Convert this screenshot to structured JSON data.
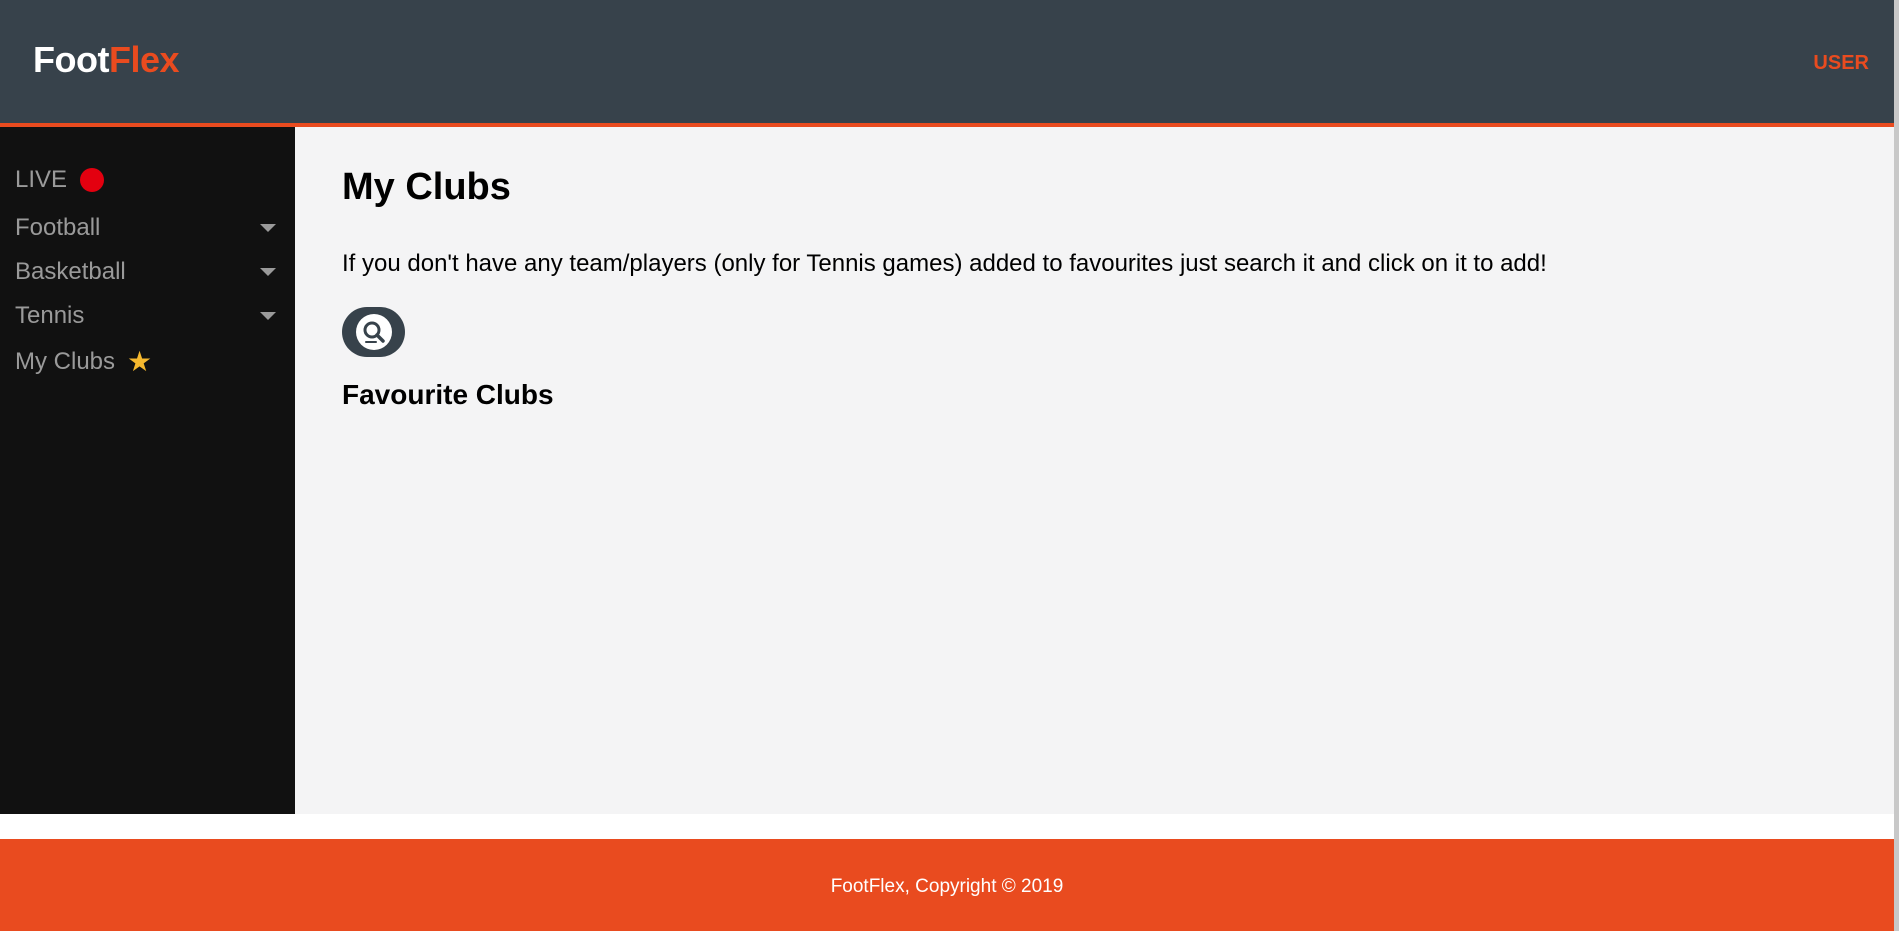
{
  "header": {
    "logo_part1": "Foot",
    "logo_part2": "Flex",
    "user_link": "USER"
  },
  "sidebar": {
    "items": [
      {
        "label": "LIVE",
        "icon": "live-dot-icon"
      },
      {
        "label": "Football",
        "icon": "caret-down-icon"
      },
      {
        "label": "Basketball",
        "icon": "caret-down-icon"
      },
      {
        "label": "Tennis",
        "icon": "caret-down-icon"
      },
      {
        "label": "My Clubs",
        "icon": "star-icon"
      }
    ]
  },
  "main": {
    "title": "My Clubs",
    "description": "If you don't have any team/players (only for Tennis games) added to favourites just search it and click on it to add!",
    "search_button_icon": "search-icon",
    "favourites_heading": "Favourite Clubs"
  },
  "footer": {
    "copyright": "FootFlex, Copyright © 2019"
  },
  "colors": {
    "header_bg": "#37424b",
    "accent": "#e94b1f",
    "sidebar_bg": "#111111",
    "main_bg": "#f4f4f5",
    "live_dot": "#e3000f",
    "star": "#f5b82e"
  }
}
